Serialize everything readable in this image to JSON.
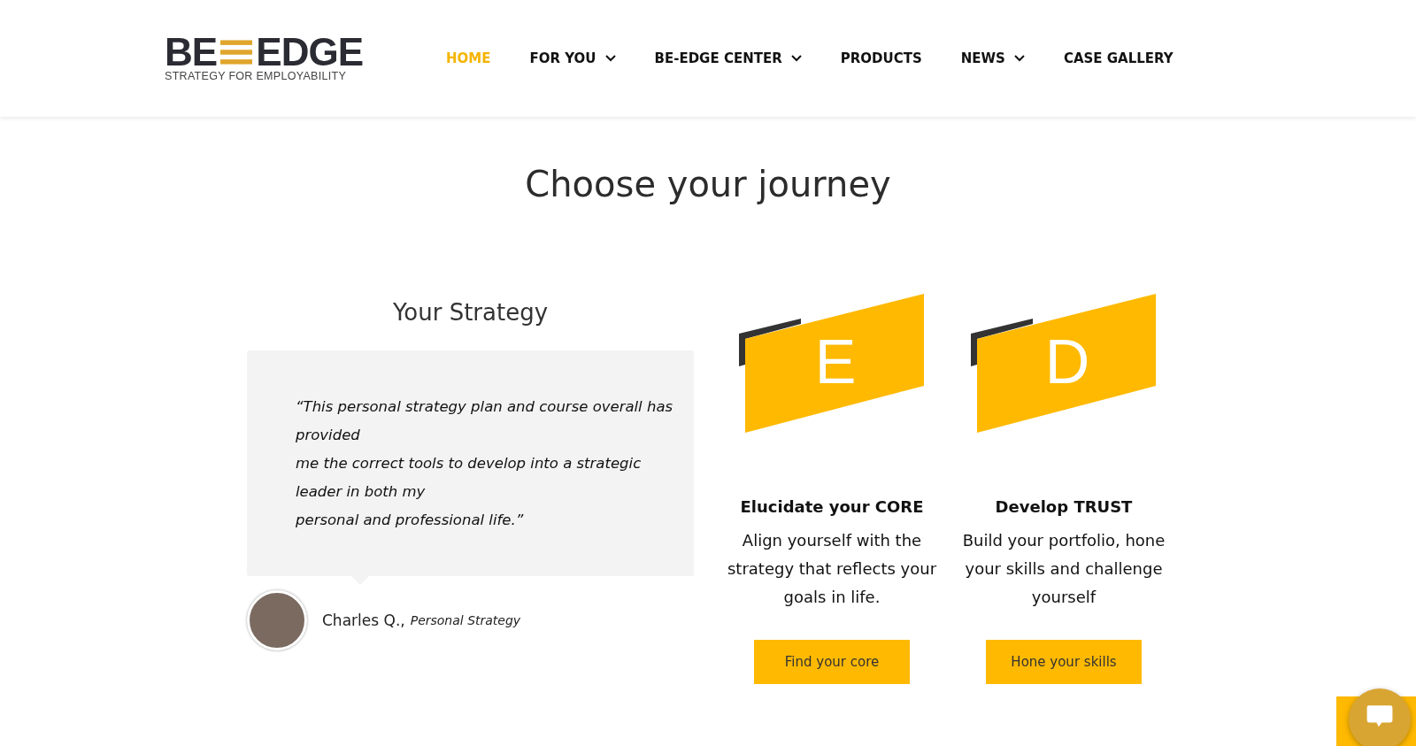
{
  "logo": {
    "left": "BE",
    "right": "EDGE",
    "tagline": "STRATEGY FOR EMPLOYABILITY"
  },
  "nav": [
    {
      "label": "HOME",
      "selected": true,
      "dropdown": false
    },
    {
      "label": "FOR YOU",
      "selected": false,
      "dropdown": true
    },
    {
      "label": "BE-EDGE CENTER",
      "selected": false,
      "dropdown": true
    },
    {
      "label": "PRODUCTS",
      "selected": false,
      "dropdown": false
    },
    {
      "label": "NEWS",
      "selected": false,
      "dropdown": true
    },
    {
      "label": "CASE GALLERY",
      "selected": false,
      "dropdown": false
    }
  ],
  "heading": "Choose your journey",
  "testimonial": {
    "title": "Your Strategy",
    "quote_lines": [
      "“This personal strategy plan and course overall has provided",
      "me the correct tools to develop into a strategic leader in both my",
      "personal and professional life.”"
    ],
    "author": "Charles Q.,",
    "role": "Personal Strategy"
  },
  "cards": [
    {
      "letter": "E",
      "title": "Elucidate your CORE",
      "text": "Align yourself with the strategy that reflects your goals in life.",
      "button": "Find your core"
    },
    {
      "letter": "D",
      "title": "Develop TRUST",
      "text": "Build your portfolio, hone your skills and challenge yourself",
      "button": "Hone your skills"
    }
  ]
}
